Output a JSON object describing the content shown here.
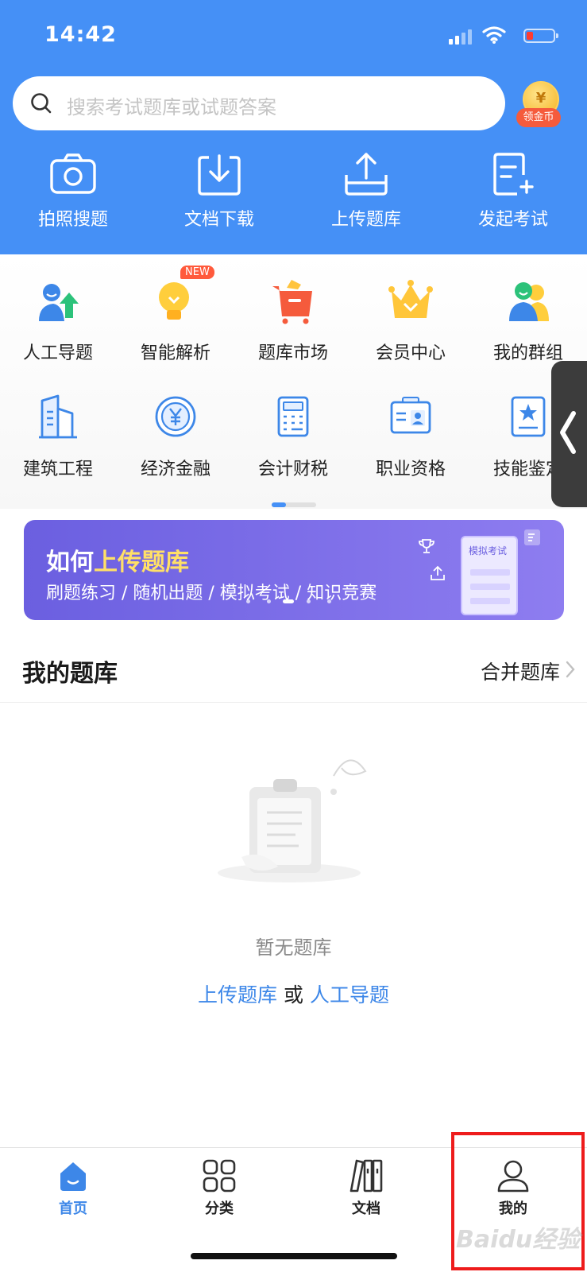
{
  "status_bar": {
    "time": "14:42"
  },
  "search": {
    "placeholder": "搜索考试题库或试题答案"
  },
  "coin": {
    "symbol": "¥",
    "label": "领金币"
  },
  "top_actions": [
    {
      "label": "拍照搜题",
      "icon": "camera-icon"
    },
    {
      "label": "文档下载",
      "icon": "download-icon"
    },
    {
      "label": "上传题库",
      "icon": "upload-icon"
    },
    {
      "label": "发起考试",
      "icon": "new-exam-icon"
    }
  ],
  "categories_row1": [
    {
      "label": "人工导题",
      "icon": "manual-import-icon"
    },
    {
      "label": "智能解析",
      "icon": "lightbulb-icon",
      "badge": "NEW"
    },
    {
      "label": "题库市场",
      "icon": "cart-icon"
    },
    {
      "label": "会员中心",
      "icon": "crown-icon"
    },
    {
      "label": "我的群组",
      "icon": "group-icon"
    }
  ],
  "categories_row2": [
    {
      "label": "建筑工程",
      "icon": "building-icon"
    },
    {
      "label": "经济金融",
      "icon": "yuan-icon"
    },
    {
      "label": "会计财税",
      "icon": "calculator-icon"
    },
    {
      "label": "职业资格",
      "icon": "id-card-icon"
    },
    {
      "label": "技能鉴定",
      "icon": "star-certificate-icon"
    }
  ],
  "banner": {
    "title_prefix": "如何",
    "title_highlight": "上传题库",
    "subtitle": "刷题练习 / 随机出题 / 模拟考试 / 知识竞赛",
    "card_text": "模拟考试"
  },
  "my_bank": {
    "title": "我的题库",
    "action": "合并题库",
    "empty_text": "暂无题库",
    "link_upload": "上传题库",
    "link_or": "或",
    "link_manual": "人工导题"
  },
  "tabs": [
    {
      "label": "首页",
      "icon": "home-icon",
      "active": true
    },
    {
      "label": "分类",
      "icon": "grid-icon",
      "active": false
    },
    {
      "label": "文档",
      "icon": "books-icon",
      "active": false
    },
    {
      "label": "我的",
      "icon": "profile-icon",
      "active": false
    }
  ],
  "colors": {
    "primary": "#4590f6",
    "link": "#3d87e8",
    "banner": "#6b5fe0",
    "highlight": "#ee1c1c"
  },
  "watermark": "Baidu经验"
}
